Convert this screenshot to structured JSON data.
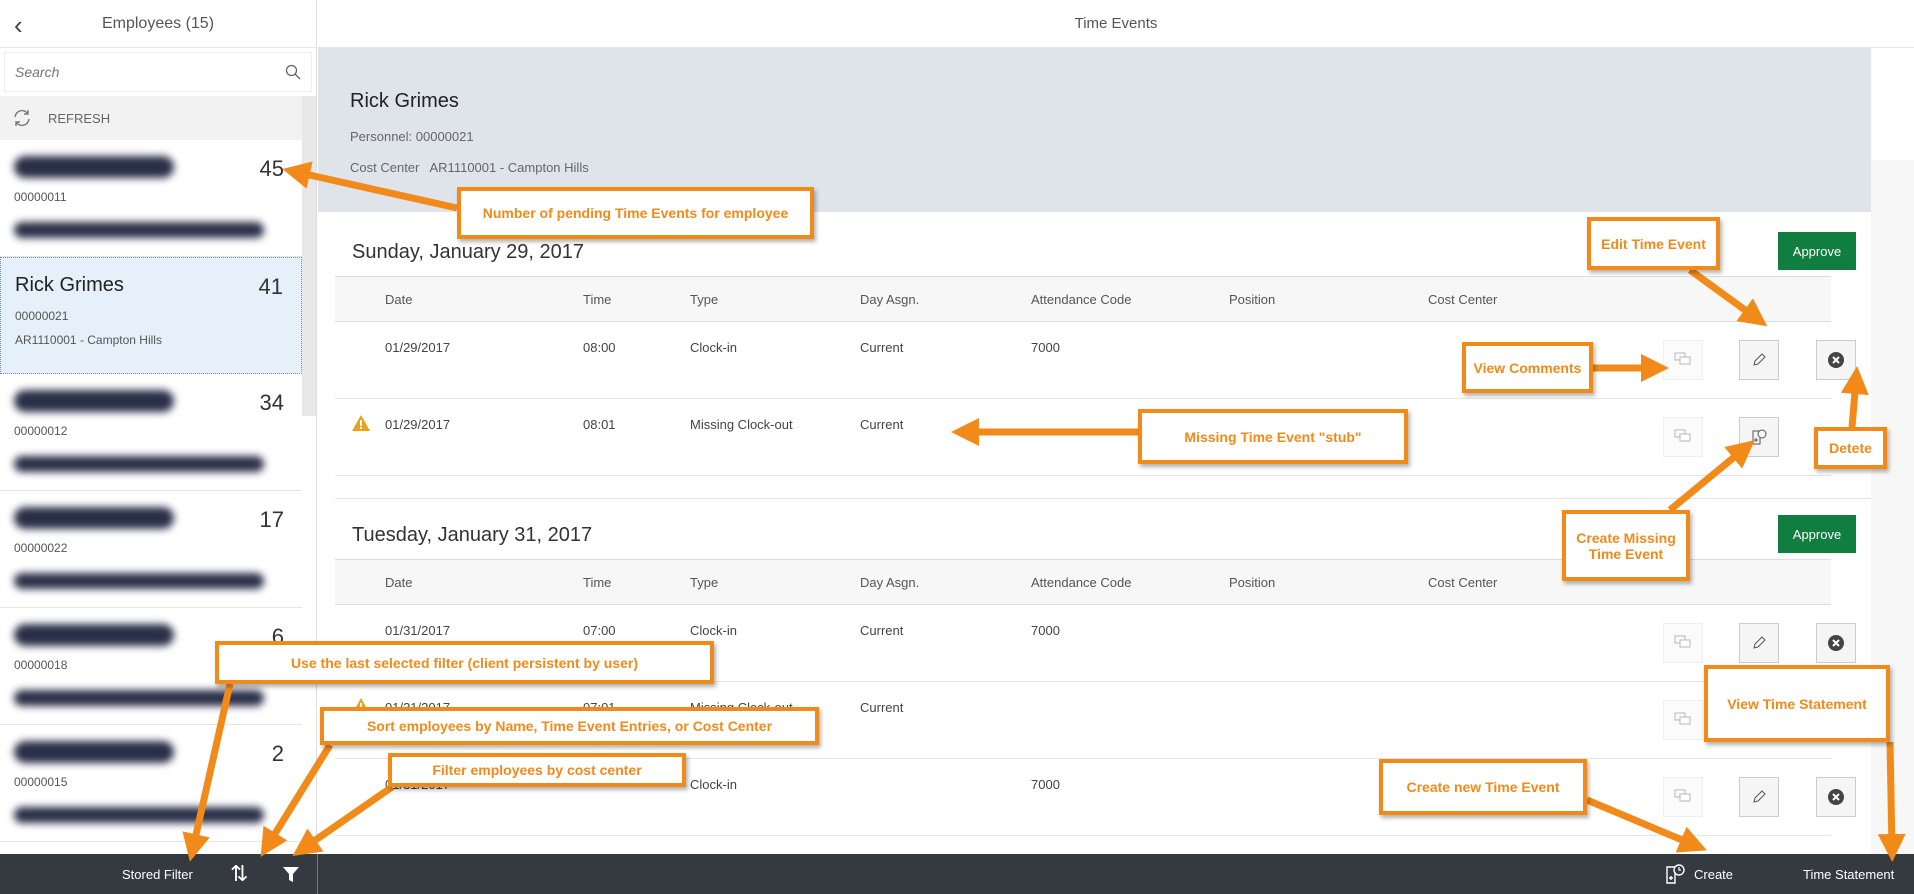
{
  "left": {
    "title": "Employees (15)",
    "search_placeholder": "Search",
    "refresh": "REFRESH",
    "employees": [
      {
        "count": "45",
        "personnel": "00000011"
      },
      {
        "name": "Rick Grimes",
        "count": "41",
        "personnel": "00000021",
        "cost_center": "AR1110001 - Campton Hills"
      },
      {
        "count": "34",
        "personnel": "00000012"
      },
      {
        "count": "17",
        "personnel": "00000022"
      },
      {
        "count": "6",
        "personnel": "00000018"
      },
      {
        "count": "2",
        "personnel": "00000015"
      }
    ]
  },
  "right": {
    "title": "Time Events",
    "employee": {
      "name": "Rick Grimes",
      "personnel": "Personnel: 00000021",
      "cost_center_label": "Cost Center",
      "cost_center": "AR1110001 - Campton Hills"
    },
    "columns": [
      "Date",
      "Time",
      "Type",
      "Day Asgn.",
      "Attendance Code",
      "Position",
      "Cost Center"
    ],
    "approve_label": "Approve",
    "days": [
      {
        "title": "Sunday, January 29, 2017",
        "rows": [
          {
            "warn": false,
            "date": "01/29/2017",
            "time": "08:00",
            "type": "Clock-in",
            "day": "Current",
            "att": "7000"
          },
          {
            "warn": true,
            "date": "01/29/2017",
            "time": "08:01",
            "type": "Missing Clock-out",
            "day": "Current",
            "att": ""
          }
        ]
      },
      {
        "title": "Tuesday, January 31, 2017",
        "rows": [
          {
            "warn": false,
            "date": "01/31/2017",
            "time": "07:00",
            "type": "Clock-in",
            "day": "Current",
            "att": "7000"
          },
          {
            "warn": true,
            "date": "01/31/2017",
            "time": "07:01",
            "type": "Missing Clock-out",
            "day": "Current",
            "att": ""
          },
          {
            "warn": false,
            "date": "01/31/2017",
            "time": "",
            "type": "Clock-in",
            "day": "",
            "att": "7000"
          }
        ]
      }
    ]
  },
  "footer": {
    "stored_filter": "Stored Filter",
    "create": "Create",
    "time_statement": "Time Statement"
  },
  "annotations": {
    "pending": "Number of pending Time Events for employee",
    "edit": "Edit Time Event",
    "comments": "View Comments",
    "stub": "Missing Time Event \"stub\"",
    "delete": "Detete",
    "create_missing": "Create Missing Time Event",
    "stored": "Use the last selected filter (client persistent by user)",
    "sort": "Sort employees by Name, Time Event Entries, or Cost Center",
    "filter": "Filter employees by cost center",
    "statement": "View Time Statement",
    "create_new": "Create new Time Event"
  },
  "colors": {
    "accent": "#f28a1a",
    "approve": "#107e3e",
    "footer": "#353a40",
    "header_band": "#dfe3ea"
  }
}
